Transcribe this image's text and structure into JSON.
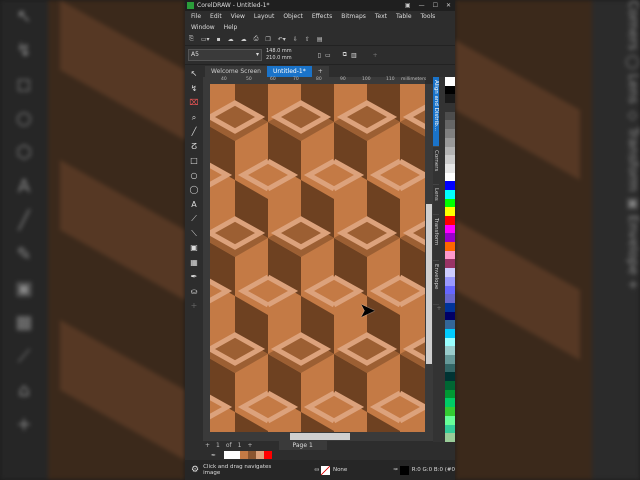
{
  "window": {
    "app_title": "CorelDRAW - Untitled-1*",
    "controls": [
      "▣",
      "—",
      "☐",
      "✕"
    ]
  },
  "menu": {
    "row1": [
      "File",
      "Edit",
      "View",
      "Layout",
      "Object",
      "Effects",
      "Bitmaps",
      "Text",
      "Table",
      "Tools"
    ],
    "row2": [
      "Window",
      "Help"
    ]
  },
  "toolbar": {
    "icons": [
      "new-icon",
      "open-icon",
      "save-icon",
      "cloud-download-icon",
      "cloud-upload-icon",
      "print-icon",
      "undo-icon",
      "import-icon",
      "export-icon",
      "publish-pdf-icon"
    ]
  },
  "property_bar": {
    "page_size": "A5",
    "width": "148.0 mm",
    "height": "210.0 mm"
  },
  "tabs": [
    {
      "label": "Welcome Screen"
    },
    {
      "label": "Untitled-1*"
    }
  ],
  "ruler": {
    "ticks": [
      "40",
      "50",
      "60",
      "70",
      "80",
      "90",
      "100",
      "110"
    ],
    "unit": "millimeters"
  },
  "page_nav": {
    "current": "1",
    "of": "of",
    "total": "1",
    "page_label": "Page 1"
  },
  "dockers": [
    {
      "label": "Align and Distrib..."
    },
    {
      "label": "Corners"
    },
    {
      "label": "Lens"
    },
    {
      "label": "Transform"
    },
    {
      "label": "Envelope"
    }
  ],
  "status": {
    "hint": "Click and drag navigates image",
    "fill": "None",
    "outline": "R:0 G:0 B:0 (#0"
  },
  "colors": {
    "accent": "#1a73c9",
    "orange": "#c47a45",
    "dark": "#6e4121",
    "mid": "#9c5f33",
    "light": "#dca27c"
  },
  "document_palette": [
    "#ffffff",
    "#c47a45",
    "#8a5530",
    "#dca27c",
    "#ff0000",
    "#222222"
  ],
  "palette": [
    "#ffffff",
    "#000000",
    "#1a1a1a",
    "#333333",
    "#4d4d4d",
    "#666666",
    "#808080",
    "#999999",
    "#b3b3b3",
    "#cccccc",
    "#e6e6e6",
    "#ffffff",
    "#0000ff",
    "#00ffff",
    "#00ff00",
    "#ffff00",
    "#ff0000",
    "#ff00ff",
    "#9900cc",
    "#ff6600",
    "#ff99cc",
    "#993366",
    "#ccccff",
    "#9999ff",
    "#6666ff",
    "#6666cc",
    "#003399",
    "#000066",
    "#336699",
    "#00ccff",
    "#99ffff",
    "#99cccc",
    "#669999",
    "#336666",
    "#003333",
    "#006633",
    "#009933",
    "#00cc66",
    "#33cc33",
    "#66ff99",
    "#33cc99",
    "#99cc99"
  ]
}
